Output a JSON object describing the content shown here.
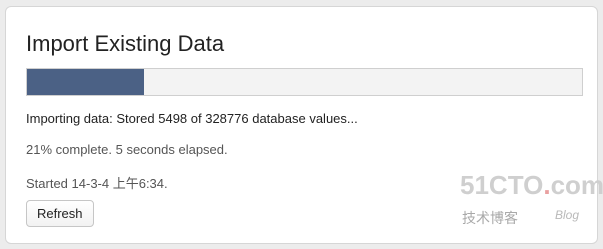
{
  "dialog": {
    "title": "Import Existing Data",
    "progress_fraction": 0.21,
    "status_text": "Importing data: Stored 5498 of 328776 database values...",
    "percent_text": "21% complete. 5 seconds elapsed.",
    "started_text": "Started 14-3-4 上午6:34.",
    "refresh_label": "Refresh"
  },
  "watermark": {
    "brand_prefix": "51CTO",
    "brand_dot": ".",
    "brand_suffix": "com",
    "subtitle": "技术博客",
    "blog": "Blog"
  },
  "colors": {
    "progress_fill": "#4b6185",
    "progress_track": "#f3f3f3"
  }
}
